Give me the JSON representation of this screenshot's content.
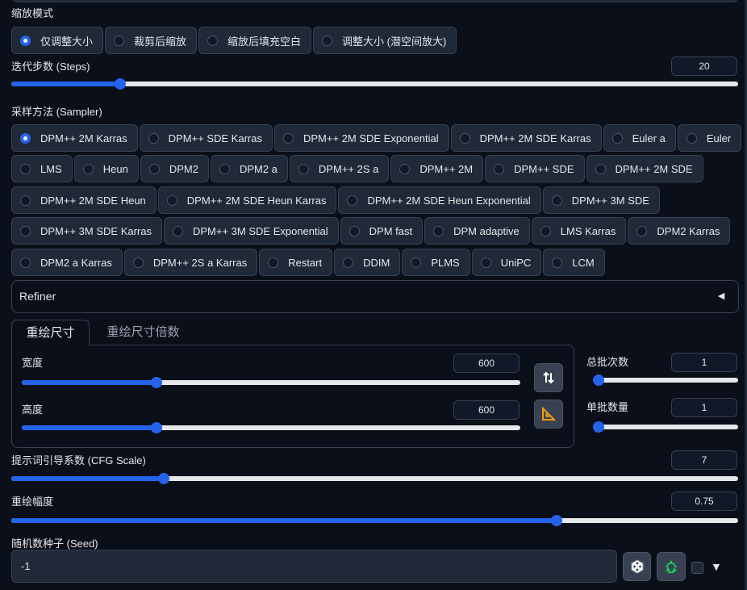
{
  "resize_mode": {
    "label": "缩放模式",
    "options": [
      "仅调整大小",
      "裁剪后缩放",
      "缩放后填充空白",
      "调整大小 (潜空间放大)"
    ],
    "selected": "仅调整大小"
  },
  "steps": {
    "label": "迭代步数 (Steps)",
    "value": "20",
    "fraction": 0.15
  },
  "sampler": {
    "label": "采样方法 (Sampler)",
    "selected": "DPM++ 2M Karras",
    "rows": [
      [
        "DPM++ 2M Karras",
        "DPM++ SDE Karras",
        "DPM++ 2M SDE Exponential",
        "DPM++ 2M SDE Karras",
        "Euler a",
        "Euler"
      ],
      [
        "LMS",
        "Heun",
        "DPM2",
        "DPM2 a",
        "DPM++ 2S a",
        "DPM++ 2M",
        "DPM++ SDE",
        "DPM++ 2M SDE"
      ],
      [
        "DPM++ 2M SDE Heun",
        "DPM++ 2M SDE Heun Karras",
        "DPM++ 2M SDE Heun Exponential",
        "DPM++ 3M SDE"
      ],
      [
        "DPM++ 3M SDE Karras",
        "DPM++ 3M SDE Exponential",
        "DPM fast",
        "DPM adaptive",
        "LMS Karras",
        "DPM2 Karras"
      ],
      [
        "DPM2 a Karras",
        "DPM++ 2S a Karras",
        "Restart",
        "DDIM",
        "PLMS",
        "UniPC",
        "LCM"
      ]
    ]
  },
  "refiner": {
    "label": "Refiner",
    "arrow": "◄"
  },
  "tabs": [
    {
      "label": "重绘尺寸",
      "active": true
    },
    {
      "label": "重绘尺寸倍数",
      "active": false
    }
  ],
  "width": {
    "label": "宽度",
    "value": "600",
    "fraction": 0.27
  },
  "height": {
    "label": "高度",
    "value": "600",
    "fraction": 0.27
  },
  "batch_count": {
    "label": "总批次数",
    "value": "1",
    "fraction": 0
  },
  "batch_size": {
    "label": "单批数量",
    "value": "1",
    "fraction": 0
  },
  "cfg": {
    "label": "提示词引导系数 (CFG Scale)",
    "value": "7",
    "fraction": 0.21
  },
  "denoise": {
    "label": "重绘幅度",
    "value": "0.75",
    "fraction": 0.75
  },
  "seed": {
    "label": "随机数种子 (Seed)",
    "value": "-1",
    "extra_arrow": "▼"
  },
  "icons": {
    "swap": "swap-dimensions-icon",
    "aspect": "triangle-ruler-icon",
    "dice": "dice-icon",
    "recycle": "recycle-icon"
  },
  "colors": {
    "accent": "#2563eb",
    "background": "#0b0f19",
    "panel": "#1f2937",
    "border": "#374151"
  }
}
